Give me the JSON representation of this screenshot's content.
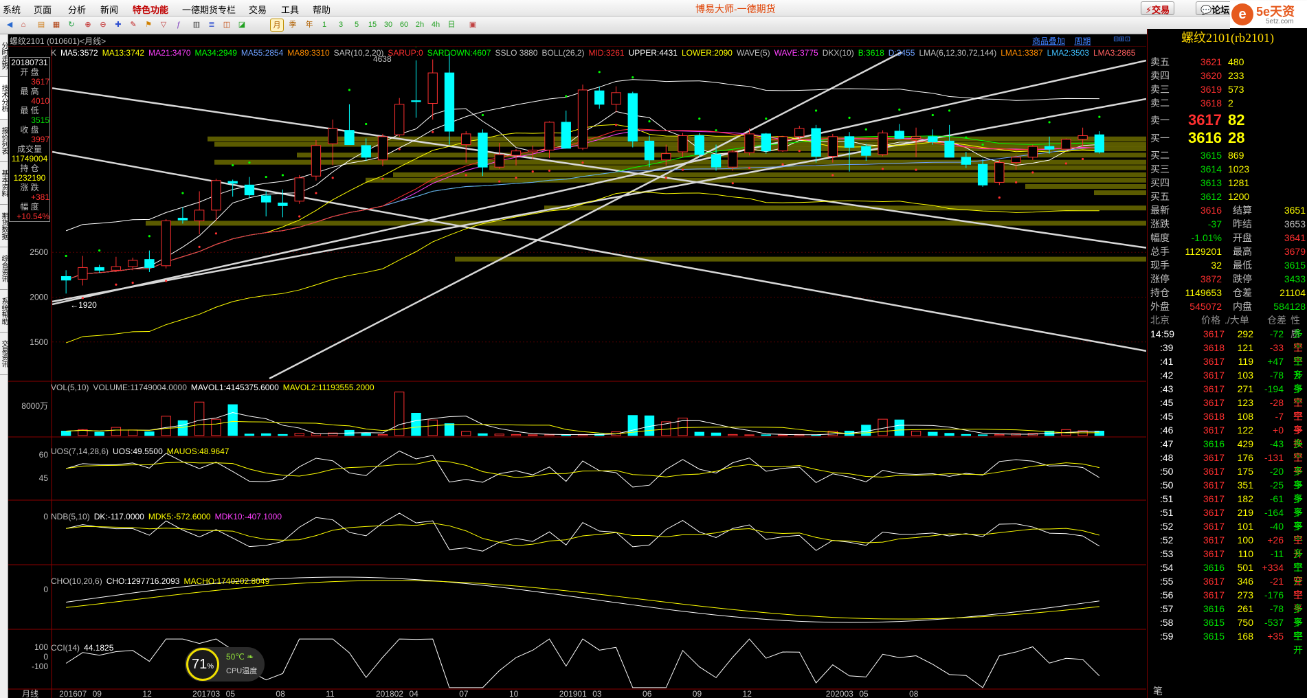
{
  "menu": [
    "系统",
    "页面",
    "分析",
    "新闻",
    "特色功能",
    "一德期货专栏",
    "交易",
    "工具",
    "帮助"
  ],
  "app_title": "博易大师-一德期货",
  "top_buttons": {
    "trade": "⚡交易",
    "forum": "💬论坛"
  },
  "logo": {
    "name": "5e天资",
    "url": "5etz.com"
  },
  "toolbar_periods": [
    "月",
    "季",
    "年",
    "1",
    "3",
    "5",
    "15",
    "30",
    "60",
    "2h",
    "4h",
    "日"
  ],
  "symbol_label": "螺纹2101 (010601)<月线>",
  "sublinks": {
    "goods": "商品叠加",
    "period": "周期"
  },
  "left_tabs": [
    "分时走势",
    "技术分析",
    "报价列表",
    "基本资料",
    "期货数据",
    "综合资讯",
    "系统帮助",
    "交易资讯"
  ],
  "main_header": [
    {
      "t": "K",
      "c": "#c0c0c0"
    },
    {
      "t": "MA5:3572",
      "c": "#ffffff"
    },
    {
      "t": "MA13:3742",
      "c": "#ffff00"
    },
    {
      "t": "MA21:3470",
      "c": "#ff40ff"
    },
    {
      "t": "MA34:2949",
      "c": "#00ff00"
    },
    {
      "t": "MA55:2854",
      "c": "#6ea0ff"
    },
    {
      "t": "MA89:3310",
      "c": "#ff8c00"
    },
    {
      "t": "SAR(10,2,20)",
      "c": "#c0c0c0"
    },
    {
      "t": "SARUP:0",
      "c": "#ff3030"
    },
    {
      "t": "SARDOWN:4607",
      "c": "#00ff00"
    },
    {
      "t": "SSLO 3880",
      "c": "#c0c0c0"
    },
    {
      "t": "BOLL(26,2)",
      "c": "#c0c0c0"
    },
    {
      "t": "MID:3261",
      "c": "#ff3030"
    },
    {
      "t": "UPPER:4431",
      "c": "#ffffff"
    },
    {
      "t": "LOWER:2090",
      "c": "#ffff00"
    },
    {
      "t": "WAVE(5)",
      "c": "#c0c0c0"
    },
    {
      "t": "WAVE:3775",
      "c": "#ff40ff"
    },
    {
      "t": "DKX(10)",
      "c": "#c0c0c0"
    },
    {
      "t": "B:3618",
      "c": "#00ff00"
    },
    {
      "t": "D:3455",
      "c": "#6ea0ff"
    },
    {
      "t": "LMA(6,12,30,72,144)",
      "c": "#c0c0c0"
    },
    {
      "t": "LMA1:3387",
      "c": "#ff8c00"
    },
    {
      "t": "LMA2:3503",
      "c": "#40c0ff"
    },
    {
      "t": "LMA3:2865",
      "c": "#ff6060"
    }
  ],
  "tooltip": {
    "date": "20180731",
    "open_label": "开 盘",
    "open": "3617",
    "high_label": "最 高",
    "high": "4010",
    "low_label": "最 低",
    "low": "3515",
    "close_label": "收 盘",
    "close": "3997",
    "vol_label": "成交量",
    "vol": "11749004",
    "oi_label": "持 仓",
    "oi": "1232190",
    "chg_label": "涨 跌",
    "chg": "+381",
    "pct_label": "幅 度",
    "pct": "+10.54%"
  },
  "price_axis": [
    "2500",
    "2000",
    "1500"
  ],
  "annotations": {
    "high": "4638",
    "low": "←1920"
  },
  "vol_header": [
    {
      "t": "VOL(5,10)",
      "c": "#c0c0c0"
    },
    {
      "t": "VOLUME:11749004.0000",
      "c": "#c0c0c0"
    },
    {
      "t": "MAVOL1:4145375.6000",
      "c": "#ffffff"
    },
    {
      "t": "MAVOL2:11193555.2000",
      "c": "#ffff00"
    }
  ],
  "vol_axis": "8000万",
  "uos_header": [
    {
      "t": "UOS(7,14,28,6)",
      "c": "#c0c0c0"
    },
    {
      "t": "UOS:49.5500",
      "c": "#ffffff"
    },
    {
      "t": "MAUOS:48.9647",
      "c": "#ffff00"
    }
  ],
  "uos_axis": [
    "60",
    "45"
  ],
  "ndb_header": [
    {
      "t": "NDB(5,10)",
      "c": "#c0c0c0"
    },
    {
      "t": "DK:-117.0000",
      "c": "#ffffff"
    },
    {
      "t": "MDK5:-572.6000",
      "c": "#ffff00"
    },
    {
      "t": "MDK10:-407.1000",
      "c": "#ff40ff"
    }
  ],
  "ndb_axis": "0",
  "cho_header": [
    {
      "t": "CHO(10,20,6)",
      "c": "#c0c0c0"
    },
    {
      "t": "CHO:1297716.2093",
      "c": "#ffffff"
    },
    {
      "t": "MACHO:1740202.8049",
      "c": "#ffff00"
    }
  ],
  "cho_axis": "0",
  "cci_header": [
    {
      "t": "CCI(14)",
      "c": "#c0c0c0"
    },
    {
      "t": "44.1825",
      "c": "#ffffff"
    }
  ],
  "cci_axis": [
    "100",
    "0",
    "-100"
  ],
  "x_axis_title": "月线",
  "x_labels": [
    "201607",
    "09",
    "12",
    "201703",
    "05",
    "08",
    "11",
    "201802",
    "04",
    "07",
    "10",
    "201901",
    "03",
    "06",
    "09",
    "12",
    "202003",
    "05",
    "08"
  ],
  "quote": {
    "title": "螺纹2101(rb2101)",
    "asks": [
      {
        "l": "卖五",
        "p": "3621",
        "v": "480"
      },
      {
        "l": "卖四",
        "p": "3620",
        "v": "233"
      },
      {
        "l": "卖三",
        "p": "3619",
        "v": "573"
      },
      {
        "l": "卖二",
        "p": "3618",
        "v": "2"
      },
      {
        "l": "卖一",
        "p": "3617",
        "v": "82"
      }
    ],
    "bids": [
      {
        "l": "买一",
        "p": "3616",
        "v": "28"
      },
      {
        "l": "买二",
        "p": "3615",
        "v": "869"
      },
      {
        "l": "买三",
        "p": "3614",
        "v": "1023"
      },
      {
        "l": "买四",
        "p": "3613",
        "v": "1281"
      },
      {
        "l": "买五",
        "p": "3612",
        "v": "1200"
      }
    ],
    "stats": [
      {
        "l1": "最新",
        "v1": "3616",
        "c1": "#ff3030",
        "l2": "结算",
        "v2": "3651",
        "c2": "#ffff00"
      },
      {
        "l1": "涨跌",
        "v1": "-37",
        "c1": "#00e000",
        "l2": "昨结",
        "v2": "3653",
        "c2": "#c0c0c0"
      },
      {
        "l1": "幅度",
        "v1": "-1.01%",
        "c1": "#00e000",
        "l2": "开盘",
        "v2": "3641",
        "c2": "#ff3030"
      },
      {
        "l1": "总手",
        "v1": "1129201",
        "c1": "#ffff00",
        "l2": "最高",
        "v2": "3679",
        "c2": "#ff3030"
      },
      {
        "l1": "现手",
        "v1": "32",
        "c1": "#ffff00",
        "l2": "最低",
        "v2": "3615",
        "c2": "#00e000"
      },
      {
        "l1": "涨停",
        "v1": "3872",
        "c1": "#ff3030",
        "l2": "跌停",
        "v2": "3433",
        "c2": "#00e000"
      },
      {
        "l1": "持仓",
        "v1": "1149653",
        "c1": "#ffff00",
        "l2": "仓差",
        "v2": "21104",
        "c2": "#ffff00"
      },
      {
        "l1": "外盘",
        "v1": "545072",
        "c1": "#ff3030",
        "l2": "内盘",
        "v2": "584128",
        "c2": "#00e000"
      }
    ],
    "tick_header": {
      "time": "北京",
      "price": "价格",
      "vol": "./大单",
      "oi": "仓差",
      "type": "性质"
    },
    "ticks": [
      {
        "t": "14:59",
        "p": "3617",
        "pc": "#ff3030",
        "v": "292",
        "o": "-72",
        "oc": "#00e000",
        "n": "多平",
        "nc": "#00e000"
      },
      {
        "t": ":39",
        "p": "3618",
        "pc": "#ff3030",
        "v": "121",
        "o": "-33",
        "oc": "#ff3030",
        "n": "空平",
        "nc": "#ff3030"
      },
      {
        "t": ":41",
        "p": "3617",
        "pc": "#ff3030",
        "v": "119",
        "o": "+47",
        "oc": "#00e000",
        "n": "空开",
        "nc": "#00e000"
      },
      {
        "t": ":42",
        "p": "3617",
        "pc": "#ff3030",
        "v": "103",
        "o": "-78",
        "oc": "#00e000",
        "n": "多平",
        "nc": "#00e000"
      },
      {
        "t": ":43",
        "p": "3617",
        "pc": "#ff3030",
        "v": "271",
        "o": "-194",
        "oc": "#00e000",
        "n": "多平",
        "nc": "#00e000"
      },
      {
        "t": ":45",
        "p": "3617",
        "pc": "#ff3030",
        "v": "123",
        "o": "-28",
        "oc": "#ff3030",
        "n": "空平",
        "nc": "#ff3030"
      },
      {
        "t": ":45",
        "p": "3618",
        "pc": "#ff3030",
        "v": "108",
        "o": "-7",
        "oc": "#ff3030",
        "n": "空平",
        "nc": "#ff3030"
      },
      {
        "t": ":46",
        "p": "3617",
        "pc": "#ff3030",
        "v": "122",
        "o": "+0",
        "oc": "#ff3030",
        "n": "多换",
        "nc": "#ff3030"
      },
      {
        "t": ":47",
        "p": "3616",
        "pc": "#00e000",
        "v": "429",
        "o": "-43",
        "oc": "#00e000",
        "n": "多平",
        "nc": "#00e000"
      },
      {
        "t": ":48",
        "p": "3617",
        "pc": "#ff3030",
        "v": "176",
        "o": "-131",
        "oc": "#ff3030",
        "n": "空平",
        "nc": "#ff3030"
      },
      {
        "t": ":50",
        "p": "3617",
        "pc": "#ff3030",
        "v": "175",
        "o": "-20",
        "oc": "#00e000",
        "n": "多平",
        "nc": "#00e000"
      },
      {
        "t": ":50",
        "p": "3617",
        "pc": "#ff3030",
        "v": "351",
        "o": "-25",
        "oc": "#00e000",
        "n": "多平",
        "nc": "#00e000"
      },
      {
        "t": ":51",
        "p": "3617",
        "pc": "#ff3030",
        "v": "182",
        "o": "-61",
        "oc": "#00e000",
        "n": "多平",
        "nc": "#00e000"
      },
      {
        "t": ":51",
        "p": "3617",
        "pc": "#ff3030",
        "v": "219",
        "o": "-164",
        "oc": "#00e000",
        "n": "多平",
        "nc": "#00e000"
      },
      {
        "t": ":52",
        "p": "3617",
        "pc": "#ff3030",
        "v": "101",
        "o": "-40",
        "oc": "#00e000",
        "n": "多平",
        "nc": "#00e000"
      },
      {
        "t": ":52",
        "p": "3617",
        "pc": "#ff3030",
        "v": "100",
        "o": "+26",
        "oc": "#ff3030",
        "n": "空开",
        "nc": "#ff3030"
      },
      {
        "t": ":53",
        "p": "3617",
        "pc": "#ff3030",
        "v": "110",
        "o": "-11",
        "oc": "#00e000",
        "n": "多平",
        "nc": "#00e000"
      },
      {
        "t": ":54",
        "p": "3616",
        "pc": "#00e000",
        "v": "501",
        "o": "+334",
        "oc": "#ff3030",
        "n": "空开",
        "nc": "#00e000"
      },
      {
        "t": ":55",
        "p": "3617",
        "pc": "#ff3030",
        "v": "346",
        "o": "-21",
        "oc": "#ff3030",
        "n": "空平",
        "nc": "#ff3030"
      },
      {
        "t": ":56",
        "p": "3617",
        "pc": "#ff3030",
        "v": "273",
        "o": "-176",
        "oc": "#00e000",
        "n": "空平",
        "nc": "#ff3030"
      },
      {
        "t": ":57",
        "p": "3616",
        "pc": "#00e000",
        "v": "261",
        "o": "-78",
        "oc": "#00e000",
        "n": "多平",
        "nc": "#00e000"
      },
      {
        "t": ":58",
        "p": "3615",
        "pc": "#00e000",
        "v": "750",
        "o": "-537",
        "oc": "#00e000",
        "n": "多平",
        "nc": "#00e000"
      },
      {
        "t": ":59",
        "p": "3615",
        "pc": "#00e000",
        "v": "168",
        "o": "+35",
        "oc": "#ff3030",
        "n": "空开",
        "nc": "#00e000"
      }
    ],
    "bottom_tab": "笔"
  },
  "gauge": {
    "percent": "71",
    "unit": "%",
    "temp": "50℃",
    "label": "CPU温度"
  },
  "colors": {
    "up": "#ff3030",
    "down": "#00ffff",
    "olive": "#6b6b00",
    "panel_border": "#8b0000"
  },
  "chart_data": {
    "type": "candlestick",
    "x_start": "2016-07",
    "interval": "month",
    "candles": [
      [
        2230,
        2300,
        2040,
        2190
      ],
      [
        2200,
        2460,
        2130,
        2330
      ],
      [
        2330,
        2360,
        2270,
        2300
      ],
      [
        2300,
        2450,
        2280,
        2340
      ],
      [
        2340,
        2440,
        2300,
        2410
      ],
      [
        2420,
        2520,
        2280,
        2330
      ],
      [
        2350,
        2870,
        2320,
        2850
      ],
      [
        2880,
        3000,
        2820,
        2860
      ],
      [
        2850,
        3180,
        2700,
        2970
      ],
      [
        2970,
        3320,
        2850,
        3300
      ],
      [
        3290,
        3310,
        3120,
        3270
      ],
      [
        3250,
        3340,
        3100,
        3140
      ],
      [
        3130,
        3180,
        2900,
        3060
      ],
      [
        3050,
        3200,
        2890,
        3020
      ],
      [
        3070,
        3360,
        3040,
        3330
      ],
      [
        3350,
        3750,
        3300,
        3690
      ],
      [
        3710,
        3980,
        3470,
        3880
      ],
      [
        3860,
        4150,
        3800,
        3700
      ],
      [
        3690,
        3770,
        3520,
        3560
      ],
      [
        3530,
        3820,
        3460,
        3790
      ],
      [
        3810,
        4220,
        3790,
        4150
      ],
      [
        4190,
        4640,
        4000,
        4180
      ],
      [
        4160,
        4650,
        3980,
        4500
      ],
      [
        4500,
        4730,
        3700,
        3850
      ],
      [
        3700,
        3850,
        3500,
        3820
      ],
      [
        3830,
        3870,
        3350,
        3450
      ],
      [
        3450,
        3720,
        3430,
        3590
      ],
      [
        3580,
        3650,
        3470,
        3630
      ],
      [
        3620,
        3690,
        3540,
        3640
      ],
      [
        3640,
        3960,
        3550,
        3950
      ],
      [
        3950,
        4080,
        3700,
        3660
      ],
      [
        3660,
        4370,
        3640,
        4310
      ],
      [
        4300,
        4350,
        4100,
        4150
      ],
      [
        4150,
        4350,
        4060,
        4280
      ],
      [
        4270,
        4290,
        3670,
        3740
      ],
      [
        3740,
        3800,
        3450,
        3530
      ],
      [
        3530,
        3700,
        3470,
        3600
      ],
      [
        3620,
        3830,
        3560,
        3800
      ],
      [
        3800,
        3830,
        3560,
        3590
      ],
      [
        3590,
        3700,
        3410,
        3450
      ],
      [
        3450,
        3640,
        3410,
        3620
      ],
      [
        3610,
        3880,
        3580,
        3820
      ],
      [
        3820,
        3830,
        3600,
        3630
      ],
      [
        3630,
        3790,
        3620,
        3790
      ],
      [
        3790,
        3910,
        3770,
        3880
      ],
      [
        3880,
        3920,
        3500,
        3570
      ],
      [
        3570,
        3820,
        3500,
        3790
      ],
      [
        3790,
        3840,
        3400,
        3670
      ],
      [
        3680,
        3710,
        3520,
        3580
      ],
      [
        3590,
        3860,
        3570,
        3830
      ],
      [
        3850,
        3930,
        3770,
        3770
      ],
      [
        3770,
        3890,
        3560,
        3790
      ],
      [
        3790,
        3870,
        3700,
        3730
      ],
      [
        3740,
        3920,
        3610,
        3560
      ],
      [
        3560,
        3620,
        3440,
        3480
      ],
      [
        3480,
        3540,
        3230,
        3250
      ],
      [
        3280,
        3530,
        3250,
        3500
      ],
      [
        3500,
        3580,
        3420,
        3560
      ],
      [
        3560,
        3700,
        3530,
        3680
      ],
      [
        3680,
        3790,
        3600,
        3650
      ],
      [
        3650,
        3770,
        3630,
        3760
      ],
      [
        3760,
        3890,
        3680,
        3800
      ],
      [
        3810,
        3850,
        3600,
        3617
      ]
    ],
    "volume": [
      1.2,
      1.6,
      0.9,
      2.2,
      1.5,
      1.0,
      5.2,
      4.0,
      9.0,
      4.4,
      8.3,
      0.4,
      0.5,
      0.3,
      0.6,
      0.5,
      0.7,
      1.4,
      0.7,
      0.3,
      11.7,
      6.0,
      4.2,
      3.2,
      1.1,
      0.5,
      0.4,
      0.3,
      0.2,
      0.3,
      0.2,
      0.3,
      0.4,
      1.0,
      5.4,
      5.3,
      3.7,
      4.7,
      0.9,
      0.7,
      0.3,
      0.2,
      0.2,
      0.2,
      0.3,
      0.2,
      1.2,
      1.2,
      2.8,
      4.4,
      4.2,
      1.2,
      0.9,
      0.6,
      0.3,
      0.2,
      0.3,
      0.5,
      0.6,
      1.2,
      1.6,
      1.3,
      1.2
    ],
    "ylim": [
      1100,
      4700
    ],
    "bands": [
      3760,
      3700,
      3650,
      3580,
      3500,
      3440,
      3360,
      3300,
      3230,
      3160,
      2990,
      2820,
      2420
    ],
    "trend_lines": [
      [
        1920,
        4638
      ],
      [
        1950,
        4210
      ],
      [
        3620,
        1400
      ],
      [
        4330,
        2550
      ]
    ]
  }
}
